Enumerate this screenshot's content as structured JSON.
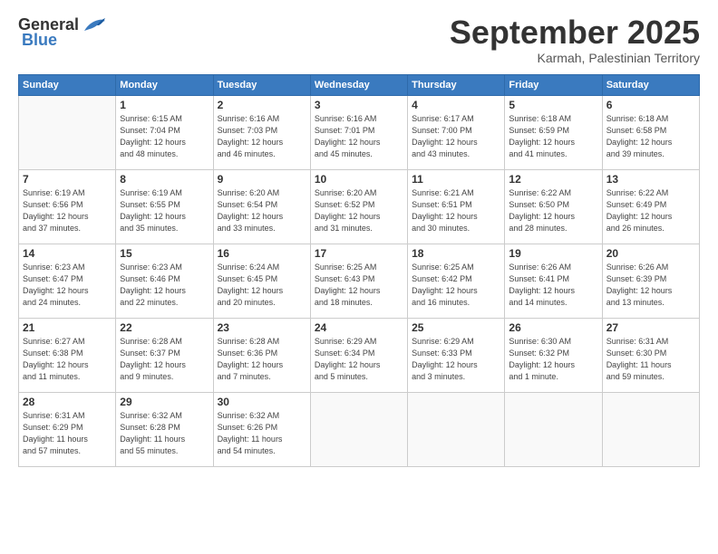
{
  "header": {
    "logo_general": "General",
    "logo_blue": "Blue",
    "month_title": "September 2025",
    "subtitle": "Karmah, Palestinian Territory"
  },
  "days_of_week": [
    "Sunday",
    "Monday",
    "Tuesday",
    "Wednesday",
    "Thursday",
    "Friday",
    "Saturday"
  ],
  "weeks": [
    [
      {
        "day": "",
        "info": ""
      },
      {
        "day": "1",
        "info": "Sunrise: 6:15 AM\nSunset: 7:04 PM\nDaylight: 12 hours\nand 48 minutes."
      },
      {
        "day": "2",
        "info": "Sunrise: 6:16 AM\nSunset: 7:03 PM\nDaylight: 12 hours\nand 46 minutes."
      },
      {
        "day": "3",
        "info": "Sunrise: 6:16 AM\nSunset: 7:01 PM\nDaylight: 12 hours\nand 45 minutes."
      },
      {
        "day": "4",
        "info": "Sunrise: 6:17 AM\nSunset: 7:00 PM\nDaylight: 12 hours\nand 43 minutes."
      },
      {
        "day": "5",
        "info": "Sunrise: 6:18 AM\nSunset: 6:59 PM\nDaylight: 12 hours\nand 41 minutes."
      },
      {
        "day": "6",
        "info": "Sunrise: 6:18 AM\nSunset: 6:58 PM\nDaylight: 12 hours\nand 39 minutes."
      }
    ],
    [
      {
        "day": "7",
        "info": "Sunrise: 6:19 AM\nSunset: 6:56 PM\nDaylight: 12 hours\nand 37 minutes."
      },
      {
        "day": "8",
        "info": "Sunrise: 6:19 AM\nSunset: 6:55 PM\nDaylight: 12 hours\nand 35 minutes."
      },
      {
        "day": "9",
        "info": "Sunrise: 6:20 AM\nSunset: 6:54 PM\nDaylight: 12 hours\nand 33 minutes."
      },
      {
        "day": "10",
        "info": "Sunrise: 6:20 AM\nSunset: 6:52 PM\nDaylight: 12 hours\nand 31 minutes."
      },
      {
        "day": "11",
        "info": "Sunrise: 6:21 AM\nSunset: 6:51 PM\nDaylight: 12 hours\nand 30 minutes."
      },
      {
        "day": "12",
        "info": "Sunrise: 6:22 AM\nSunset: 6:50 PM\nDaylight: 12 hours\nand 28 minutes."
      },
      {
        "day": "13",
        "info": "Sunrise: 6:22 AM\nSunset: 6:49 PM\nDaylight: 12 hours\nand 26 minutes."
      }
    ],
    [
      {
        "day": "14",
        "info": "Sunrise: 6:23 AM\nSunset: 6:47 PM\nDaylight: 12 hours\nand 24 minutes."
      },
      {
        "day": "15",
        "info": "Sunrise: 6:23 AM\nSunset: 6:46 PM\nDaylight: 12 hours\nand 22 minutes."
      },
      {
        "day": "16",
        "info": "Sunrise: 6:24 AM\nSunset: 6:45 PM\nDaylight: 12 hours\nand 20 minutes."
      },
      {
        "day": "17",
        "info": "Sunrise: 6:25 AM\nSunset: 6:43 PM\nDaylight: 12 hours\nand 18 minutes."
      },
      {
        "day": "18",
        "info": "Sunrise: 6:25 AM\nSunset: 6:42 PM\nDaylight: 12 hours\nand 16 minutes."
      },
      {
        "day": "19",
        "info": "Sunrise: 6:26 AM\nSunset: 6:41 PM\nDaylight: 12 hours\nand 14 minutes."
      },
      {
        "day": "20",
        "info": "Sunrise: 6:26 AM\nSunset: 6:39 PM\nDaylight: 12 hours\nand 13 minutes."
      }
    ],
    [
      {
        "day": "21",
        "info": "Sunrise: 6:27 AM\nSunset: 6:38 PM\nDaylight: 12 hours\nand 11 minutes."
      },
      {
        "day": "22",
        "info": "Sunrise: 6:28 AM\nSunset: 6:37 PM\nDaylight: 12 hours\nand 9 minutes."
      },
      {
        "day": "23",
        "info": "Sunrise: 6:28 AM\nSunset: 6:36 PM\nDaylight: 12 hours\nand 7 minutes."
      },
      {
        "day": "24",
        "info": "Sunrise: 6:29 AM\nSunset: 6:34 PM\nDaylight: 12 hours\nand 5 minutes."
      },
      {
        "day": "25",
        "info": "Sunrise: 6:29 AM\nSunset: 6:33 PM\nDaylight: 12 hours\nand 3 minutes."
      },
      {
        "day": "26",
        "info": "Sunrise: 6:30 AM\nSunset: 6:32 PM\nDaylight: 12 hours\nand 1 minute."
      },
      {
        "day": "27",
        "info": "Sunrise: 6:31 AM\nSunset: 6:30 PM\nDaylight: 11 hours\nand 59 minutes."
      }
    ],
    [
      {
        "day": "28",
        "info": "Sunrise: 6:31 AM\nSunset: 6:29 PM\nDaylight: 11 hours\nand 57 minutes."
      },
      {
        "day": "29",
        "info": "Sunrise: 6:32 AM\nSunset: 6:28 PM\nDaylight: 11 hours\nand 55 minutes."
      },
      {
        "day": "30",
        "info": "Sunrise: 6:32 AM\nSunset: 6:26 PM\nDaylight: 11 hours\nand 54 minutes."
      },
      {
        "day": "",
        "info": ""
      },
      {
        "day": "",
        "info": ""
      },
      {
        "day": "",
        "info": ""
      },
      {
        "day": "",
        "info": ""
      }
    ]
  ]
}
